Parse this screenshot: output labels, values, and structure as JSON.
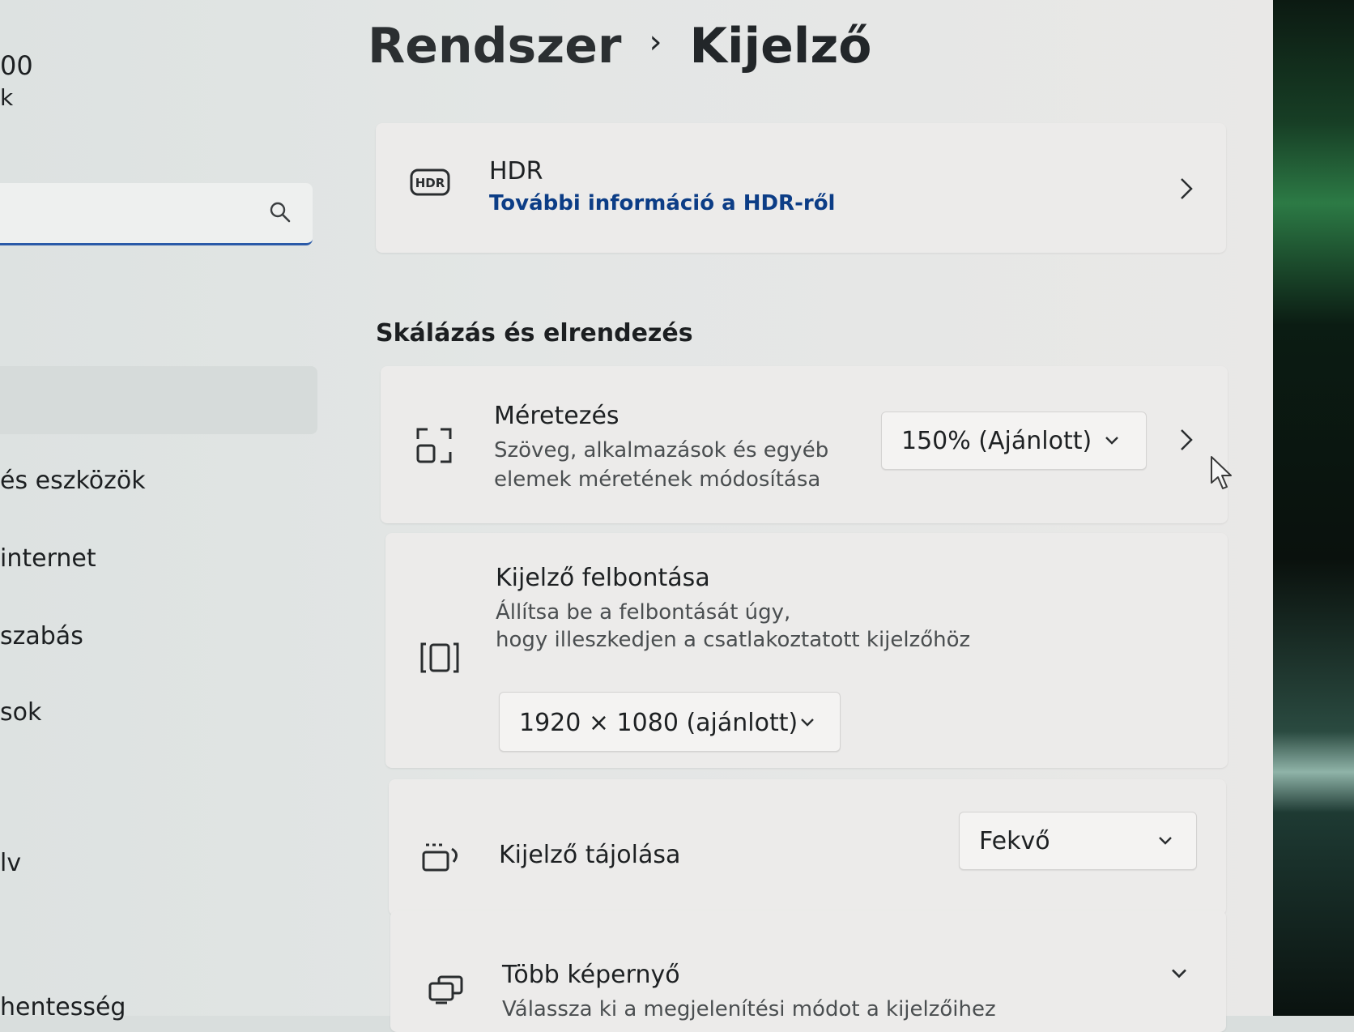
{
  "sidebar": {
    "clock_partial": "00",
    "clock_sub_partial": "k",
    "items": [
      {
        "label": "és eszközök"
      },
      {
        "label": "internet"
      },
      {
        "label": "szabás"
      },
      {
        "label": "sok"
      },
      {
        "label": "lv"
      },
      {
        "label": "hentesség"
      }
    ]
  },
  "breadcrumb": {
    "parent": "Rendszer",
    "separator": "›",
    "current": "Kijelző"
  },
  "hdr": {
    "icon_text": "HDR",
    "title": "HDR",
    "link": "További információ a HDR-ről"
  },
  "section": {
    "heading": "Skálázás és elrendezés"
  },
  "scale": {
    "title": "Méretezés",
    "sub1": "Szöveg, alkalmazások és egyéb",
    "sub2": "elemek méretének módosítása",
    "value": "150% (Ajánlott)"
  },
  "resolution": {
    "title": "Kijelző felbontása",
    "sub1": "Állítsa be a felbontását úgy,",
    "sub2": "hogy illeszkedjen a csatlakoztatott kijelzőhöz",
    "value": "1920 × 1080 (ajánlott)"
  },
  "orientation": {
    "title": "Kijelző tájolása",
    "value": "Fekvő"
  },
  "multi": {
    "title": "Több képernyő",
    "sub": "Válassza ki a megjelenítési módot a kijelzőihez"
  }
}
